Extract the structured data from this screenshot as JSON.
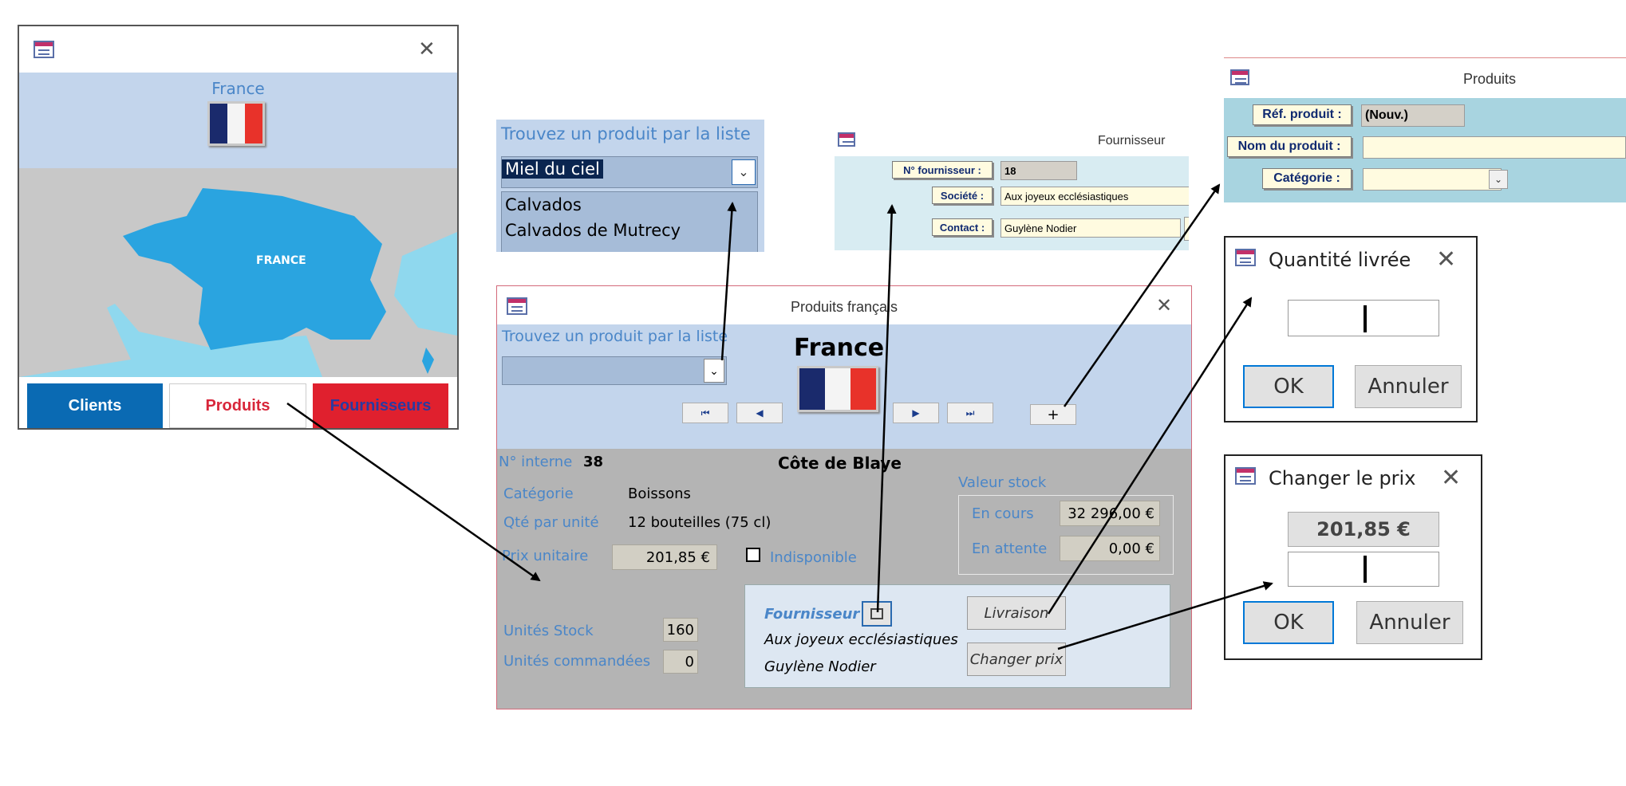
{
  "menu_window": {
    "country": "France",
    "map_label": "FRANCE",
    "buttons": {
      "clients": "Clients",
      "produits": "Produits",
      "fournisseurs": "Fournisseurs"
    },
    "colors": {
      "clients": "#0a6ab3",
      "produits": "#d8263a",
      "fournisseurs": "#e0202e"
    }
  },
  "product_finder": {
    "label": "Trouvez un produit par la liste",
    "selected": "Miel du ciel",
    "items": [
      "Calvados",
      "Calvados de Mutrecy"
    ]
  },
  "fournisseur_form": {
    "title": "Fournisseur",
    "labels": {
      "num": "N° fournisseur :",
      "societe": "Société :",
      "contact": "Contact :"
    },
    "values": {
      "num": "18",
      "societe": "Aux joyeux ecclésiastiques",
      "contact": "Guylène Nodier"
    }
  },
  "produits_form": {
    "title": "Produits",
    "labels": {
      "ref": "Réf. produit :",
      "nom": "Nom du produit :",
      "categorie": "Catégorie :"
    },
    "values": {
      "ref": "(Nouv.)",
      "nom": "",
      "categorie": ""
    }
  },
  "main_form": {
    "title": "Produits français",
    "finder_label": "Trouvez un produit par la liste",
    "country": "France",
    "add_symbol": "+",
    "interne_label": "N° interne",
    "interne_value": "38",
    "product_name": "Côte de Blaye",
    "categorie_label": "Catégorie",
    "categorie_value": "Boissons",
    "qte_label": "Qté par unité",
    "qte_value": "12 bouteilles (75 cl)",
    "prix_label": "Prix unitaire",
    "prix_value": "201,85 €",
    "indisponible_label": "Indisponible",
    "valeur_stock_label": "Valeur stock",
    "en_cours_label": "En cours",
    "en_cours_value": "32 296,00 €",
    "en_attente_label": "En attente",
    "en_attente_value": "0,00 €",
    "unites_stock_label": "Unités Stock",
    "unites_stock_value": "160",
    "unites_cmd_label": "Unités commandées",
    "unites_cmd_value": "0",
    "fournisseur_label": "Fournisseur",
    "fournisseur_name": "Aux joyeux ecclésiastiques",
    "fournisseur_contact": "Guylène Nodier",
    "livraison_button": "Livraison",
    "changer_prix_button": "Changer prix"
  },
  "dialog_quantite": {
    "title": "Quantité livrée",
    "ok": "OK",
    "cancel": "Annuler"
  },
  "dialog_prix": {
    "title": "Changer le prix",
    "current_price": "201,85 €",
    "ok": "OK",
    "cancel": "Annuler"
  }
}
